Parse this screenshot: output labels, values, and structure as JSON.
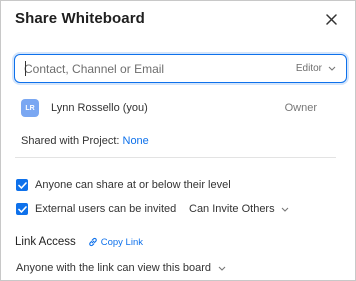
{
  "dialog": {
    "title": "Share Whiteboard"
  },
  "invite": {
    "placeholder": "Contact, Channel or Email",
    "value": "",
    "role_label": "Editor"
  },
  "members": [
    {
      "initials": "LR",
      "name": "Lynn Rossello (you)",
      "role": "Owner"
    }
  ],
  "project": {
    "label": "Shared with Project:",
    "value": "None"
  },
  "options": {
    "share_level_label": "Anyone can share at or below their level",
    "share_level_checked": true,
    "external_label": "External users can be invited",
    "external_checked": true,
    "invite_others_label": "Can Invite Others"
  },
  "link_access": {
    "label": "Link Access",
    "copy_link_label": "Copy Link",
    "access_setting": "Anyone with the link can view this board"
  },
  "colors": {
    "accent": "#0e71eb",
    "avatar": "#7aa7f2"
  }
}
